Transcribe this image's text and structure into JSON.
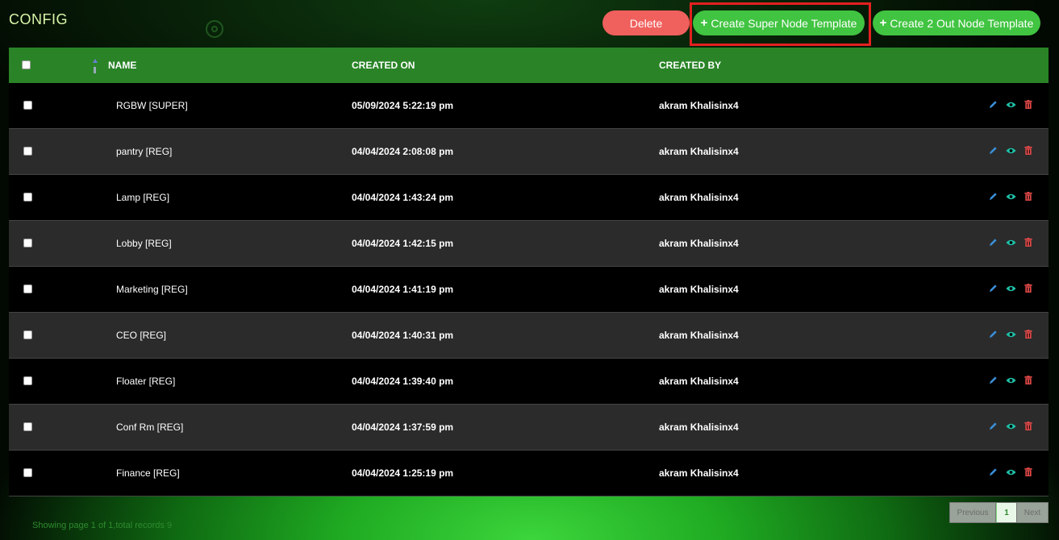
{
  "header": {
    "title": "CONFIG",
    "delete_label": "Delete",
    "create_super_label": "Create Super Node Template",
    "create_two_out_label": "Create 2 Out Node Template"
  },
  "table": {
    "columns": {
      "name": "NAME",
      "created_on": "CREATED ON",
      "created_by": "CREATED BY"
    },
    "rows": [
      {
        "name": "RGBW [SUPER]",
        "created_on": "05/09/2024 5:22:19 pm",
        "created_by": "akram Khalisinx4"
      },
      {
        "name": "pantry [REG]",
        "created_on": "04/04/2024 2:08:08 pm",
        "created_by": "akram Khalisinx4"
      },
      {
        "name": "Lamp [REG]",
        "created_on": "04/04/2024 1:43:24 pm",
        "created_by": "akram Khalisinx4"
      },
      {
        "name": "Lobby [REG]",
        "created_on": "04/04/2024 1:42:15 pm",
        "created_by": "akram Khalisinx4"
      },
      {
        "name": "Marketing [REG]",
        "created_on": "04/04/2024 1:41:19 pm",
        "created_by": "akram Khalisinx4"
      },
      {
        "name": "CEO [REG]",
        "created_on": "04/04/2024 1:40:31 pm",
        "created_by": "akram Khalisinx4"
      },
      {
        "name": "Floater [REG]",
        "created_on": "04/04/2024 1:39:40 pm",
        "created_by": "akram Khalisinx4"
      },
      {
        "name": "Conf Rm [REG]",
        "created_on": "04/04/2024 1:37:59 pm",
        "created_by": "akram Khalisinx4"
      },
      {
        "name": "Finance [REG]",
        "created_on": "04/04/2024 1:25:19 pm",
        "created_by": "akram Khalisinx4"
      }
    ]
  },
  "footer": {
    "status": "Showing page 1 of 1,total records 9",
    "previous_label": "Previous",
    "current_page": "1",
    "next_label": "Next"
  },
  "colors": {
    "header_row": "#2a8427",
    "delete_button": "#f0605d",
    "create_button": "#41c441",
    "edit_icon": "#3a8fd8",
    "view_icon": "#1fc1a8",
    "delete_icon": "#e04848"
  },
  "icons": {
    "edit": "pencil-icon",
    "view": "eye-icon",
    "delete": "trash-icon",
    "sort": "sort-icon"
  }
}
